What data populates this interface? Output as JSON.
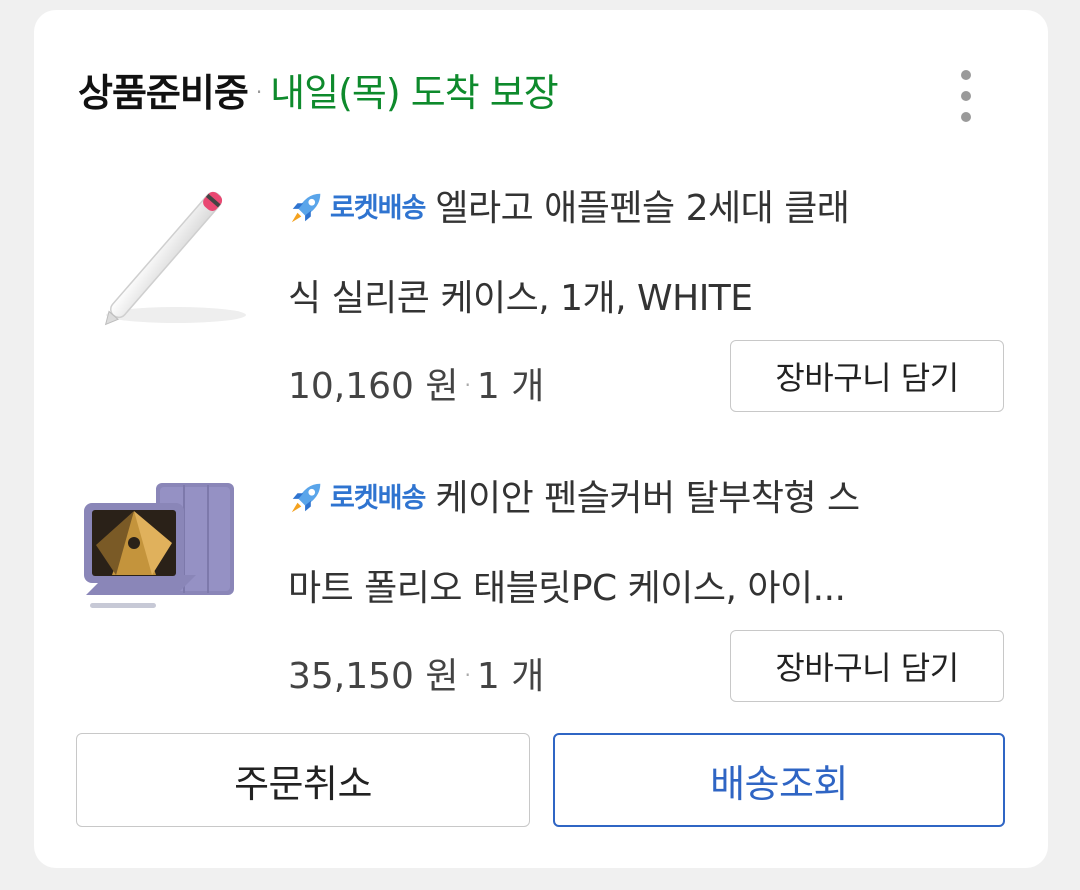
{
  "header": {
    "status": "상품준비중",
    "separator": "·",
    "eta": "내일(목) 도착 보장"
  },
  "items": [
    {
      "badge": "로켓배송",
      "title_line1": "엘라고 애플펜슬 2세대 클래",
      "title_line2": "식 실리콘 케이스, 1개, WHITE",
      "price": "10,160 원",
      "price_sep": "·",
      "qty": "1 개",
      "cart_label": "장바구니 담기"
    },
    {
      "badge": "로켓배송",
      "title_line1": "케이안 펜슬커버 탈부착형 스",
      "title_line2": "마트 폴리오 태블릿PC 케이스, 아이...",
      "price": "35,150 원",
      "price_sep": "·",
      "qty": "1 개",
      "cart_label": "장바구니 담기"
    }
  ],
  "actions": {
    "cancel_label": "주문취소",
    "track_label": "배송조회"
  },
  "colors": {
    "eta": "#0e8a2c",
    "badge": "#2f74d0",
    "track": "#2f65c4"
  },
  "icons": [
    "more-vertical-icon",
    "rocket-icon"
  ]
}
